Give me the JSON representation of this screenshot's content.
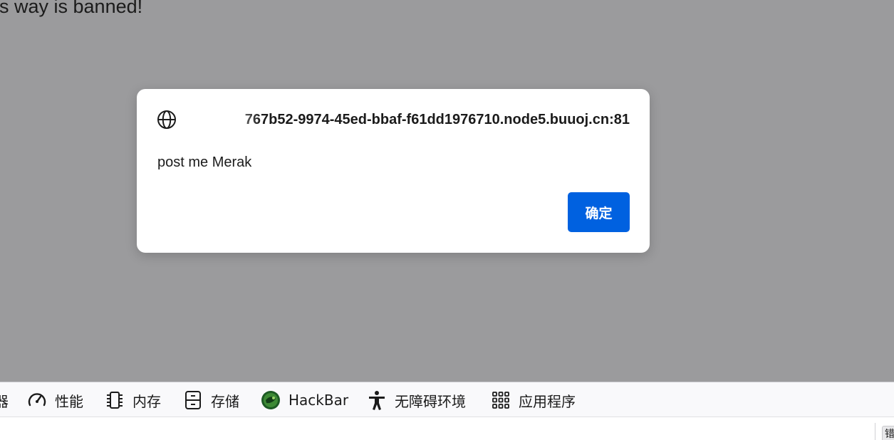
{
  "page": {
    "visible_text": "is way is banned!"
  },
  "dialog": {
    "origin": "767b52-9974-45ed-bbaf-f61dd1976710.node5.buuoj.cn:81",
    "message": "post me Merak",
    "ok_label": "确定",
    "ok_color": "#0061e0",
    "icon": "globe-icon"
  },
  "devtools": {
    "partial_tab_label": "器",
    "tabs": [
      {
        "label": "性能",
        "icon": "performance-gauge-icon"
      },
      {
        "label": "内存",
        "icon": "memory-chip-icon"
      },
      {
        "label": "存储",
        "icon": "storage-icon"
      },
      {
        "label": "HackBar",
        "icon": "hackbar-logo-icon"
      },
      {
        "label": "无障碍环境",
        "icon": "accessibility-icon"
      },
      {
        "label": "应用程序",
        "icon": "application-grid-icon"
      }
    ]
  },
  "bottom_bar": {
    "chip_text": "错"
  }
}
